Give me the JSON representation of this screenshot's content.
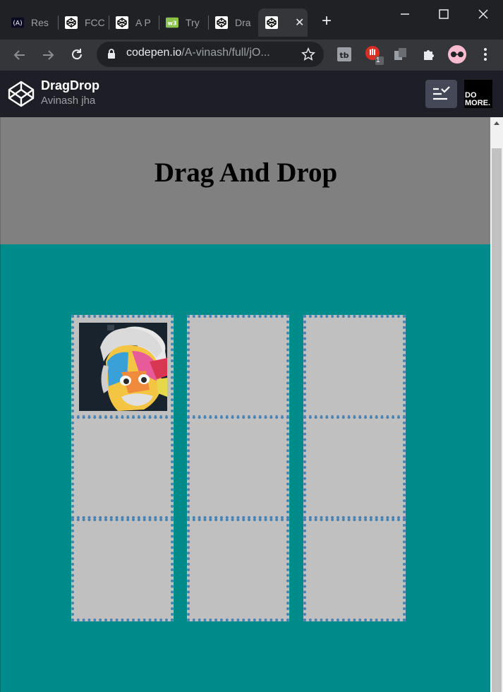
{
  "tabs": [
    {
      "title": "Res",
      "icon": "freecodecamp-icon"
    },
    {
      "title": "FCC",
      "icon": "codepen-icon"
    },
    {
      "title": "A P",
      "icon": "codepen-icon"
    },
    {
      "title": "Try",
      "icon": "w3schools-icon"
    },
    {
      "title": "Dra",
      "icon": "codepen-icon"
    },
    {
      "title": "",
      "icon": "codepen-icon",
      "active": true
    }
  ],
  "toolbar": {
    "url_host": "codepen.io",
    "url_path": "/A-vinash/full/jO...",
    "extension_badge": "1"
  },
  "codepen": {
    "title": "DragDrop",
    "author": "Avinash jha",
    "domore_line1": "DO",
    "domore_line2": "MORE."
  },
  "page": {
    "title": "Drag And Drop",
    "colors": {
      "header": "#808080",
      "body": "#008b8b",
      "cell": "#c0c0c0",
      "cell_border": "#4682b4"
    },
    "grid": {
      "columns": 3,
      "rows": 3,
      "image_cell": "row 1, column 1",
      "image_alt": "Colorful painted portrait of Einstein"
    }
  }
}
